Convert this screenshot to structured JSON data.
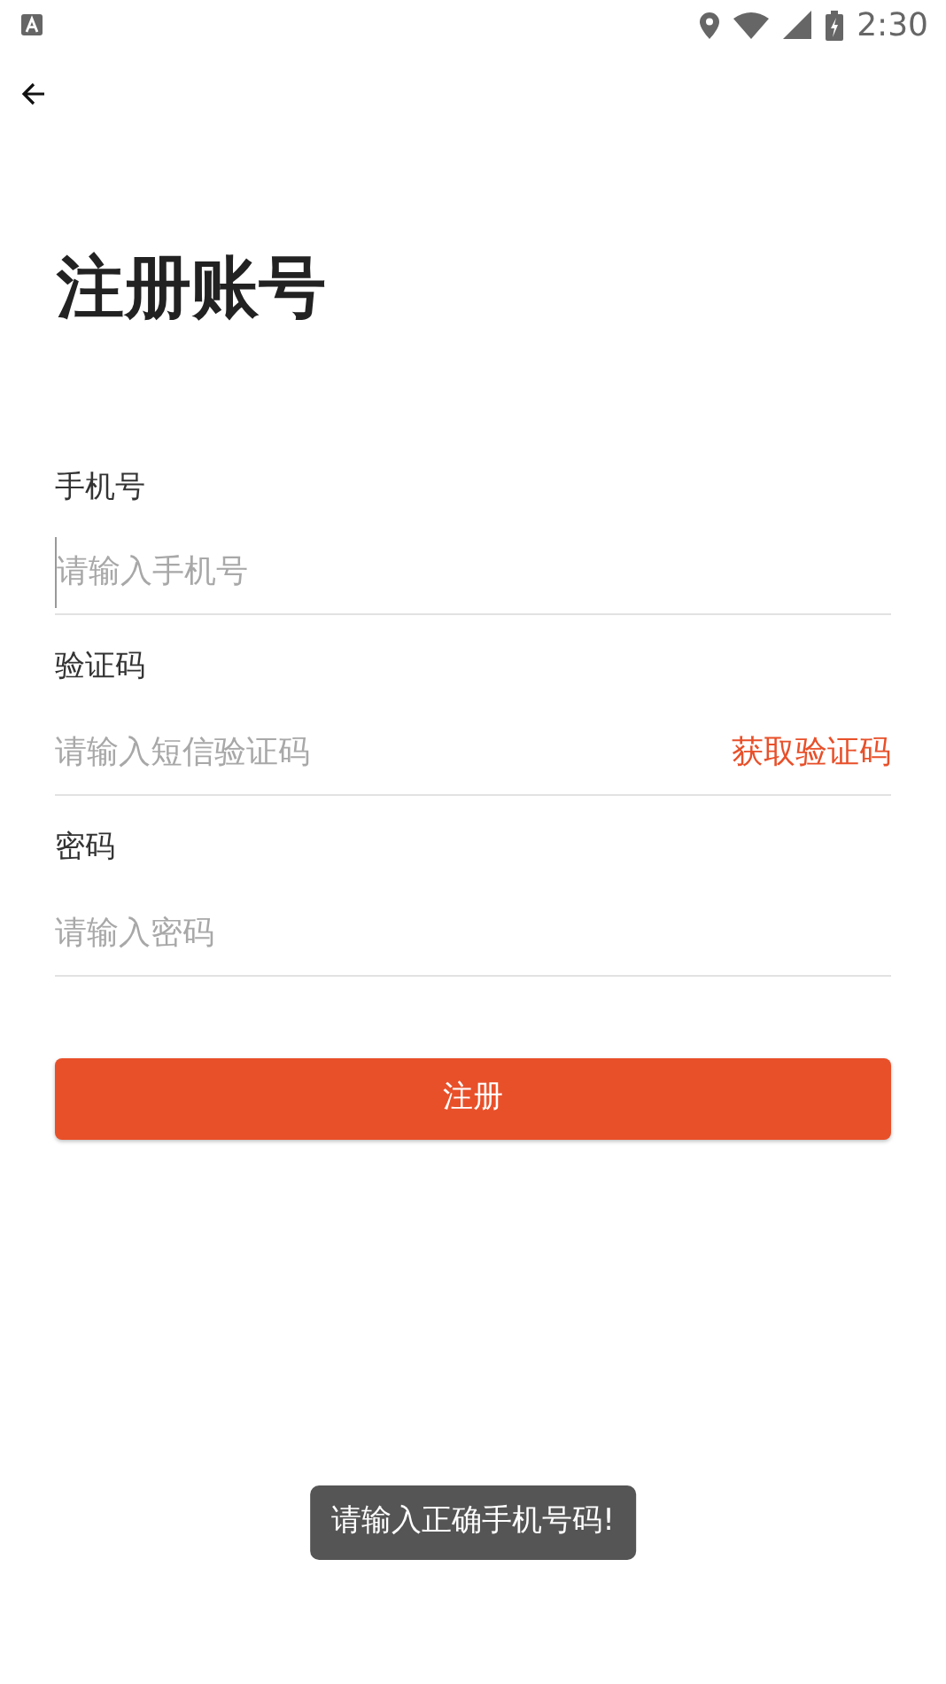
{
  "status_bar": {
    "time": "2:30"
  },
  "title": "注册账号",
  "fields": [
    {
      "kind": "text",
      "label": "手机号",
      "placeholder": "请输入手机号",
      "focused": true
    },
    {
      "kind": "code",
      "label": "验证码",
      "placeholder": "请输入短信验证码",
      "focused": false,
      "action": "获取验证码"
    },
    {
      "kind": "password",
      "label": "密码",
      "placeholder": "请输入密码",
      "focused": false
    }
  ],
  "submit": "注册",
  "toast": "请输入正确手机号码!"
}
